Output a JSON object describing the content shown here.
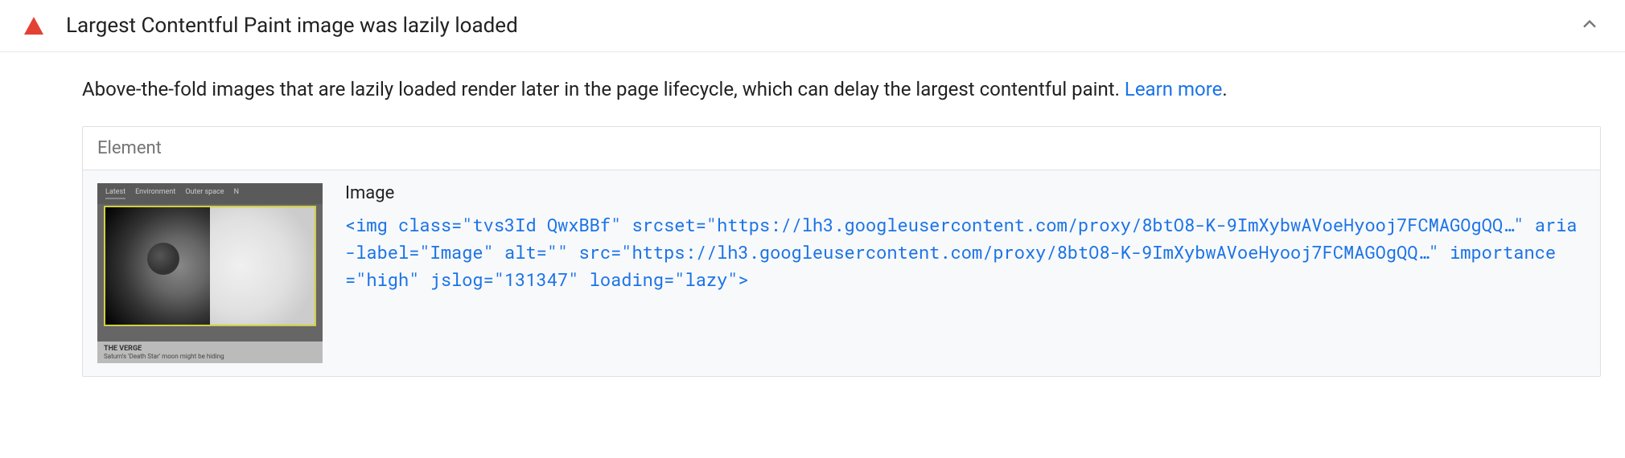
{
  "audit": {
    "title": "Largest Contentful Paint image was lazily loaded",
    "description_text": "Above-the-fold images that are lazily loaded render later in the page lifecycle, which can delay the largest contentful paint. ",
    "learn_more_label": "Learn more",
    "table_header": "Element",
    "element": {
      "label": "Image",
      "thumbnail": {
        "tabs": [
          "Latest",
          "Environment",
          "Outer space",
          "N"
        ],
        "source_badge": "THE VERGE",
        "caption": "Saturn's 'Death Star' moon might be hiding"
      },
      "snippet": {
        "tag": "img",
        "attributes": [
          {
            "name": "class",
            "value": "tvs3Id QwxBBf"
          },
          {
            "name": "srcset",
            "value": "https://lh3.googleusercontent.com/proxy/8btO8-K-9ImXybwAVoeHyooj7FCMAGOgQQ…"
          },
          {
            "name": "aria-label",
            "value": "Image"
          },
          {
            "name": "alt",
            "value": ""
          },
          {
            "name": "src",
            "value": "https://lh3.googleusercontent.com/proxy/8btO8-K-9ImXybwAVoeHyooj7FCMAGOgQQ…"
          },
          {
            "name": "importance",
            "value": "high"
          },
          {
            "name": "jslog",
            "value": "131347"
          },
          {
            "name": "loading",
            "value": "lazy"
          }
        ]
      }
    }
  }
}
